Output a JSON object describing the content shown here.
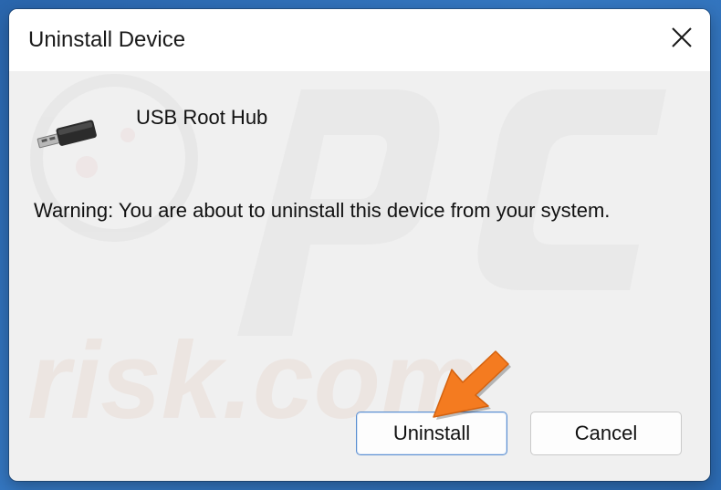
{
  "dialog": {
    "title": "Uninstall Device",
    "close_icon": "close-icon",
    "device_icon": "usb-plug-icon",
    "device_name": "USB Root Hub",
    "warning": "Warning: You are about to uninstall this device from your system.",
    "buttons": {
      "uninstall_label": "Uninstall",
      "cancel_label": "Cancel"
    }
  },
  "watermark": {
    "text": "risk.com"
  },
  "annotation": {
    "arrow_icon": "arrow-pointer-icon",
    "arrow_color": "#f47b20"
  },
  "colors": {
    "accent": "#5b8fd1",
    "dialog_bg": "#f0f0f0",
    "backdrop": "#2f6fb6"
  }
}
